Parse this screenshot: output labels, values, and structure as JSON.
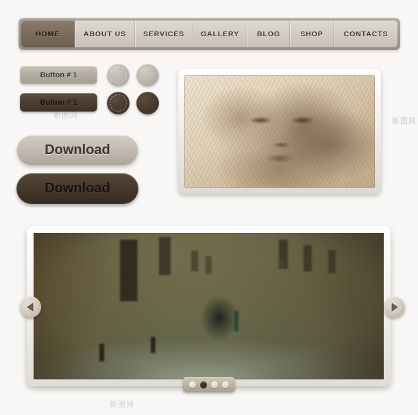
{
  "nav": {
    "items": [
      {
        "label": "HOME",
        "active": true
      },
      {
        "label": "ABOUT US",
        "active": false
      },
      {
        "label": "SERVICES",
        "active": false
      },
      {
        "label": "GALLERY",
        "active": false
      },
      {
        "label": "BLOG",
        "active": false
      },
      {
        "label": "SHOP",
        "active": false
      },
      {
        "label": "CONTACTS",
        "active": false
      }
    ]
  },
  "buttons": {
    "rect_light_label": "Button # 1",
    "rect_dark_label": "Button # 1",
    "download_light_label": "Download",
    "download_dark_label": "Download"
  },
  "circles": {
    "items": [
      {
        "name": "circle-button-light-ringed",
        "style": "light",
        "ringed": true
      },
      {
        "name": "circle-button-light-plain",
        "style": "light",
        "ringed": false
      },
      {
        "name": "circle-button-dark-ringed",
        "style": "dark",
        "ringed": true
      },
      {
        "name": "circle-button-dark-plain",
        "style": "dark",
        "ringed": false
      }
    ]
  },
  "portrait": {
    "caption": "",
    "icon": "portrait-image"
  },
  "slider": {
    "prev_icon": "chevron-left-icon",
    "next_icon": "chevron-right-icon",
    "dots": [
      {
        "active": false
      },
      {
        "active": true
      },
      {
        "active": false
      },
      {
        "active": false
      }
    ]
  },
  "watermarks": {
    "texts": [
      "新图网",
      "新图网",
      "新图网",
      "新图网"
    ]
  },
  "colors": {
    "page_background": "#f8f7f5",
    "nav_bar": "#a59b90",
    "nav_active_tab": "#7b6c5b",
    "nav_tab": "#d3cdc5",
    "dark_button": "#46392d",
    "light_button": "#c3bcb2",
    "frame": "#ffffff",
    "dot_active": "#33291e"
  }
}
